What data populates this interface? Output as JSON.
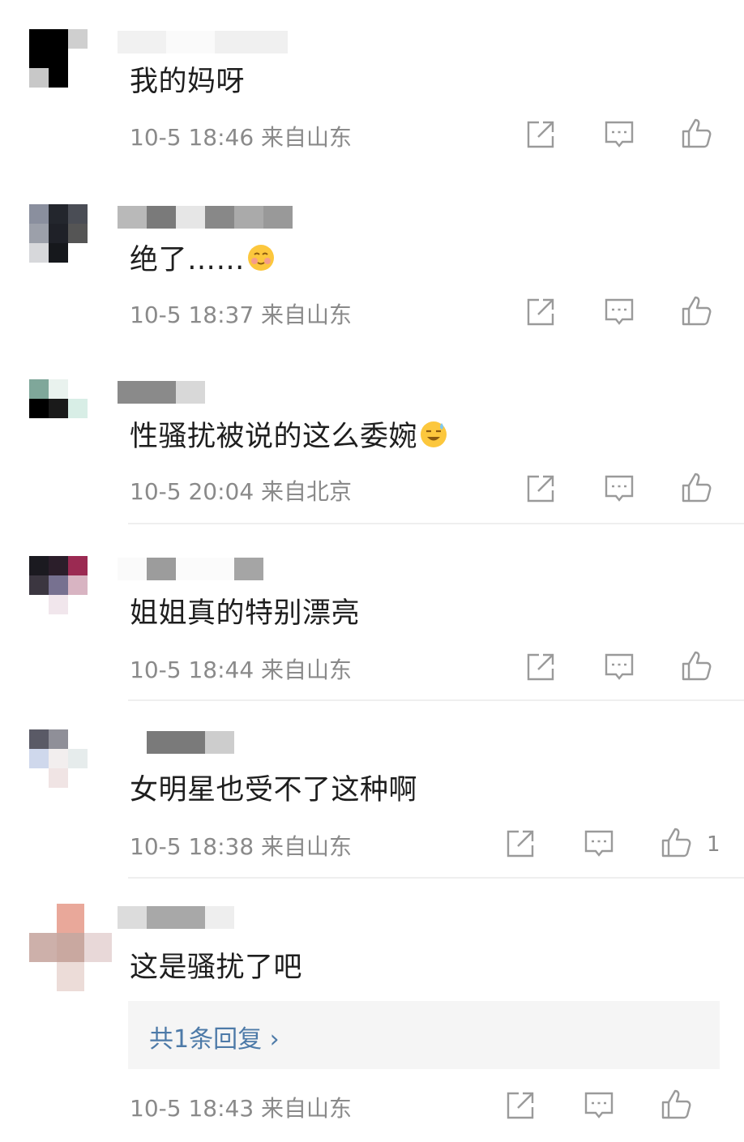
{
  "comments": [
    {
      "text": "我的妈呀",
      "meta": "10-5 18:46 来自山东"
    },
    {
      "text": "绝了……",
      "meta": "10-5 18:37 来自山东"
    },
    {
      "text": "性骚扰被说的这么委婉",
      "meta": "10-5 20:04 来自北京"
    },
    {
      "text": "姐姐真的特别漂亮",
      "meta": "10-5 18:44 来自山东"
    },
    {
      "text": "女明星也受不了这种啊",
      "meta": "10-5 18:38 来自山东",
      "like_count": "1"
    },
    {
      "text": "这是骚扰了吧",
      "meta": "10-5 18:43 来自山东",
      "reply_label": "共1条回复 ›"
    }
  ],
  "icons": {
    "share": "share-icon",
    "comment": "comment-icon",
    "like": "thumbs-up-icon"
  },
  "colors": {
    "text": "#1e1e1e",
    "meta": "#8a8a8a",
    "reply_link": "#4d7aa8",
    "reply_bg": "#f5f5f5"
  }
}
